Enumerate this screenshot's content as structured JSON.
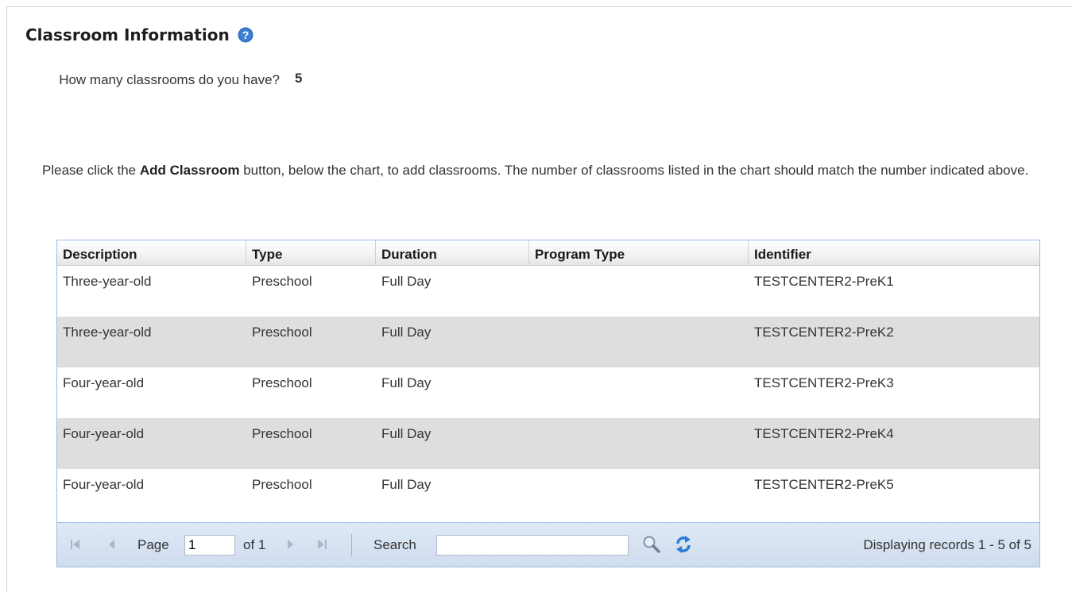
{
  "section": {
    "title": "Classroom Information",
    "help_icon": "question-circle-icon"
  },
  "question": {
    "label": "How many classrooms do you have?",
    "value": "5"
  },
  "instructions": {
    "text_before": "Please click the ",
    "bold": "Add Classroom",
    "text_after": " button, below the chart, to add classrooms. The number of classrooms listed in the chart should match the number indicated above."
  },
  "grid": {
    "columns": [
      "Description",
      "Type",
      "Duration",
      "Program Type",
      "Identifier"
    ],
    "rows": [
      {
        "description": "Three-year-old",
        "type": "Preschool",
        "duration": "Full Day",
        "program_type": "",
        "identifier": "TESTCENTER2-PreK1"
      },
      {
        "description": "Three-year-old",
        "type": "Preschool",
        "duration": "Full Day",
        "program_type": "",
        "identifier": "TESTCENTER2-PreK2"
      },
      {
        "description": "Four-year-old",
        "type": "Preschool",
        "duration": "Full Day",
        "program_type": "",
        "identifier": "TESTCENTER2-PreK3"
      },
      {
        "description": "Four-year-old",
        "type": "Preschool",
        "duration": "Full Day",
        "program_type": "",
        "identifier": "TESTCENTER2-PreK4"
      },
      {
        "description": "Four-year-old",
        "type": "Preschool",
        "duration": "Full Day",
        "program_type": "",
        "identifier": "TESTCENTER2-PreK5"
      }
    ]
  },
  "pager": {
    "page_label": "Page",
    "page_value": "1",
    "of_label": "of 1",
    "search_label": "Search",
    "search_value": "",
    "status": "Displaying records 1 - 5 of 5",
    "icons": [
      "first-page-icon",
      "prev-page-icon",
      "next-page-icon",
      "last-page-icon",
      "search-magnifier-icon",
      "refresh-icon"
    ]
  },
  "colors": {
    "help_icon": "#2f6ebf",
    "grid_border": "#99bbe8",
    "alt_row": "#dedede",
    "pager_bg": "#dfe9f5",
    "refresh_icon": "#2b7bd8"
  }
}
